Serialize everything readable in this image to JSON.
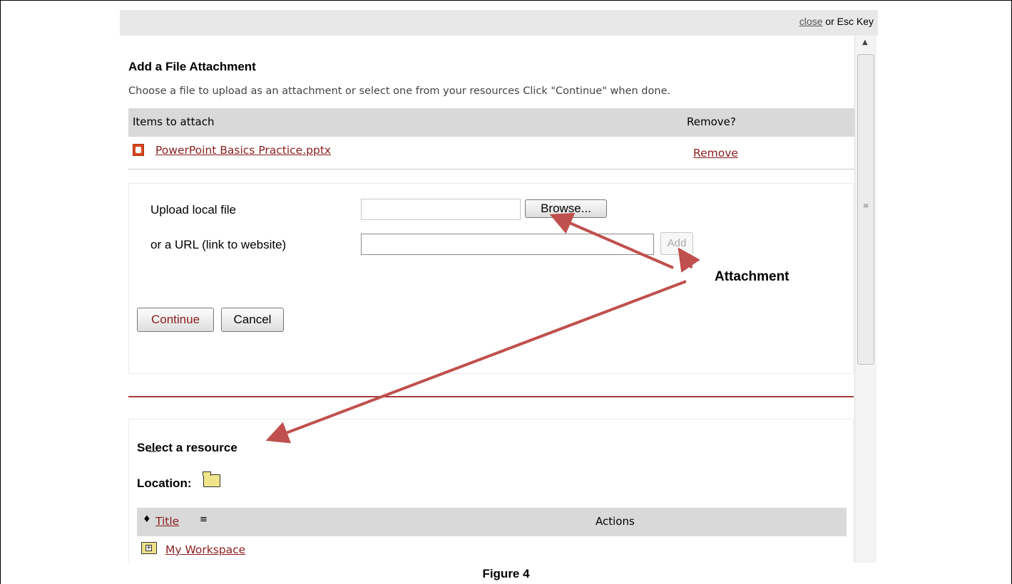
{
  "topbar": {
    "close_link": "close",
    "close_suffix": " or Esc Key"
  },
  "dialog": {
    "title": "Add a File Attachment",
    "description": "Choose a file to upload as an attachment or select one from your resources Click \"Continue\" when done."
  },
  "attachments": {
    "header_items": "Items to attach",
    "header_remove": "Remove?",
    "items": [
      {
        "name": "PowerPoint Basics Practice.pptx",
        "remove_label": "Remove",
        "icon": "pptx-file-icon"
      }
    ]
  },
  "upload": {
    "local_label": "Upload local file",
    "browse_label": "Browse...",
    "url_label": "or a URL (link to website)",
    "url_value": "",
    "add_label": "Add",
    "continue_label": "Continue",
    "cancel_label": "Cancel"
  },
  "resources": {
    "title": "Select a resource",
    "location_label": "Location:",
    "location_icon": "folder-icon",
    "columns": {
      "sort_icon": "sort-updown-icon",
      "title": "Title",
      "filter_icon": "filter-icon",
      "actions": "Actions"
    },
    "rows": [
      {
        "label": "My Workspace",
        "icon": "folder-expand-icon"
      }
    ]
  },
  "annotation": {
    "label": "Attachment",
    "arrow_color": "#c0504d"
  },
  "caption": "Figure 4",
  "colors": {
    "link": "#8a1d1d",
    "divider": "#a83a3a",
    "header_bg": "#d9d9d9",
    "topbar_bg": "#e8e8e8"
  }
}
